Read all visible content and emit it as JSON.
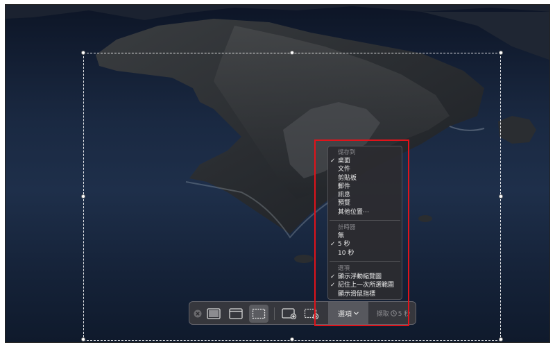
{
  "menu": {
    "save_to": {
      "header": "儲存到",
      "items": [
        {
          "label": "桌面",
          "checked": true
        },
        {
          "label": "文件",
          "checked": false
        },
        {
          "label": "剪貼板",
          "checked": false
        },
        {
          "label": "郵件",
          "checked": false
        },
        {
          "label": "訊息",
          "checked": false
        },
        {
          "label": "預覽",
          "checked": false
        },
        {
          "label": "其他位置⋯",
          "checked": false
        }
      ]
    },
    "timer": {
      "header": "計時器",
      "items": [
        {
          "label": "無",
          "checked": false
        },
        {
          "label": "5 秒",
          "checked": true
        },
        {
          "label": "10 秒",
          "checked": false
        }
      ]
    },
    "options": {
      "header": "選項",
      "items": [
        {
          "label": "顯示浮動縮覽圖",
          "checked": true
        },
        {
          "label": "記住上一次所選範圍",
          "checked": true
        },
        {
          "label": "顯示滑鼠指標",
          "checked": false
        }
      ]
    }
  },
  "toolbar": {
    "options_label": "選項",
    "capture_label": "擷取",
    "capture_timer": "5 秒",
    "icons": [
      "close-icon",
      "capture-entire-screen-icon",
      "capture-window-icon",
      "capture-selection-icon",
      "record-entire-screen-icon",
      "record-selection-icon"
    ]
  },
  "colors": {
    "highlight": "#e0131a",
    "toolbar_bg": "#3a3a3e",
    "menu_bg": "#2c2c30"
  }
}
